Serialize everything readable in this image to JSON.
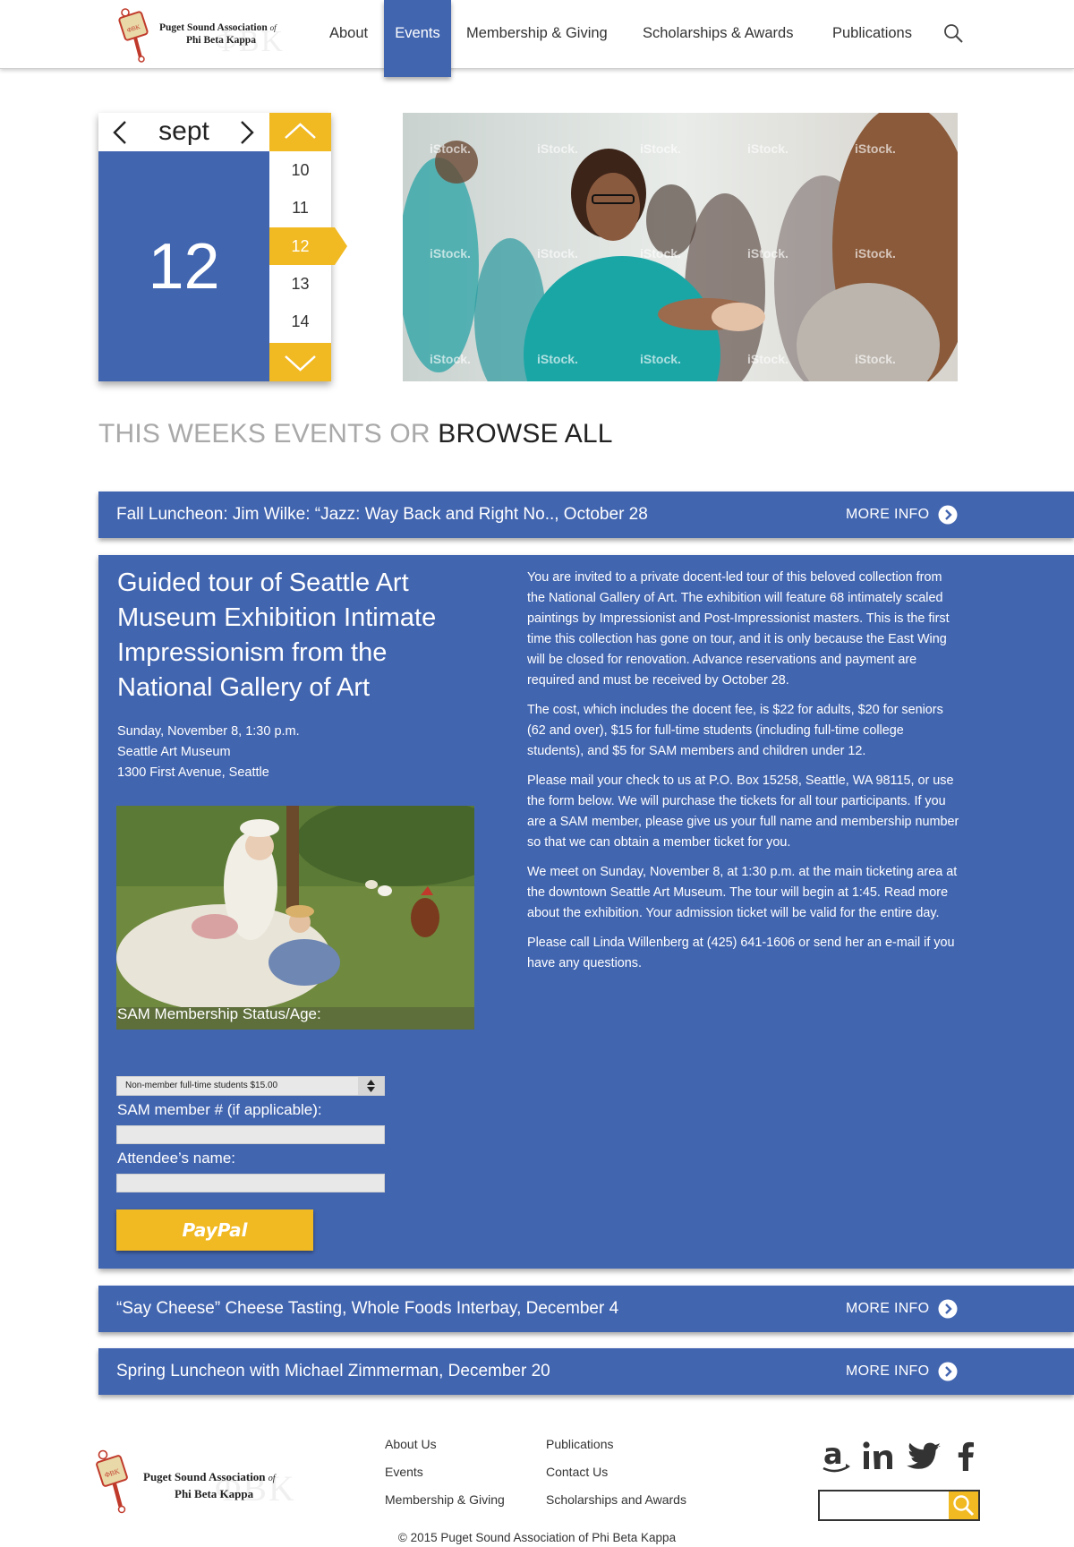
{
  "header": {
    "logo": {
      "line1": "Puget Sound Association",
      "of": "of",
      "line2": "Phi Beta Kappa"
    },
    "nav": [
      {
        "label": "About"
      },
      {
        "label": "Events",
        "active": true
      },
      {
        "label": "Membership & Giving"
      },
      {
        "label": "Scholarships & Awards"
      },
      {
        "label": "Publications"
      }
    ],
    "search_icon": "search-icon"
  },
  "datepicker": {
    "month": "sept",
    "selected_day": "12",
    "days": [
      "10",
      "11",
      "12",
      "13",
      "14"
    ]
  },
  "hero": {
    "watermark": "iStock."
  },
  "section_heading": {
    "light": "THIS WEEKS EVENTS OR ",
    "dark": "BROWSE ALL"
  },
  "events": [
    {
      "title": "Fall Luncheon: Jim Wilke: “Jazz: Way Back and Right No.., October 28",
      "more": "MORE INFO"
    },
    {
      "title": "“Say Cheese” Cheese Tasting, Whole Foods Interbay, December 4",
      "more": "MORE INFO"
    },
    {
      "title": "Spring Luncheon with Michael Zimmerman, December 20",
      "more": "MORE INFO"
    }
  ],
  "expanded_event": {
    "title": "Guided tour of Seattle Art Museum Exhibition Intimate Impressionism from the National Gallery of Art",
    "date": "Sunday, November 8, 1:30 p.m.",
    "venue": "Seattle Art Museum",
    "address": "1300 First Avenue, Seattle",
    "paragraphs": [
      "You are invited to a private docent-led tour of this beloved collection from the National Gallery of Art. The exhibition will feature 68 intimately scaled paintings by Impressionist and Post-Impressionist masters. This is the first time this collection has gone on tour, and it is only because the East Wing will be closed for renovation. Advance reservations and payment are required and must be received by October 28.",
      "The cost, which includes the docent fee, is $22 for adults, $20 for seniors (62 and over), $15 for full-time students (including full-time college students), and $5 for SAM members and children under 12.",
      "Please mail your check to us at P.O. Box 15258, Seattle, WA 98115, or use the form below. We will purchase the tickets for all tour participants. If you are a SAM member, please give us your full name and membership number so that we can obtain a member ticket for you.",
      "We meet on Sunday, November 8, at 1:30 p.m. at the main ticketing area at the downtown Seattle Art Museum. The tour will begin at 1:45. Read more about the exhibition. Your admission ticket will be valid for the entire day.",
      "Please call Linda Willenberg at (425) 641-1606 or send her an e-mail if you have any questions."
    ],
    "form": {
      "membership_label": "SAM Membership Status/Age:",
      "membership_value": "Non-member full-time students $15.00",
      "member_number_label": "SAM member # (if applicable):",
      "member_number_value": "",
      "attendee_label": "Attendee’s name:",
      "attendee_value": "",
      "pay_button": "PayPal"
    }
  },
  "footer": {
    "logo": {
      "line1": "Puget Sound Association",
      "of": "of",
      "line2": "Phi Beta Kappa"
    },
    "links_col1": [
      "About Us",
      "Events",
      "Membership & Giving"
    ],
    "links_col2": [
      "Publications",
      "Contact Us",
      "Scholarships and Awards"
    ],
    "social_icons": [
      "amazon-icon",
      "linkedin-icon",
      "twitter-icon",
      "facebook-icon"
    ],
    "search_value": "",
    "copyright": "© 2015 Puget Sound Association of Phi Beta Kappa"
  },
  "colors": {
    "primary_blue": "#4265b0",
    "accent_yellow": "#f1b922",
    "text_dark": "#333333",
    "heading_gray": "#a9a9a9"
  }
}
